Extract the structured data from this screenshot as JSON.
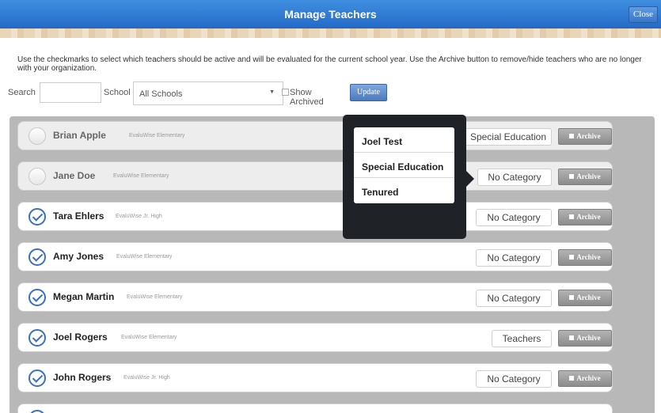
{
  "window": {
    "title": "Manage Teachers",
    "close_label": "Close"
  },
  "instructions": "Use the checkmarks to select which teachers should be active and will be evaluated for the current school year. Use the Archive button to remove/hide teachers who are no longer with your organization.",
  "filters": {
    "search_label": "Search",
    "search_value": "",
    "school_label": "School",
    "school_selected": "All Schools",
    "show_archived_label": "Show Archived",
    "update_label": "Update"
  },
  "archive_label": "Archive",
  "teachers": [
    {
      "name": "Brian Apple",
      "school": "EvaluWise Elementary",
      "category": "Special Education",
      "active": false
    },
    {
      "name": "Jane Doe",
      "school": "EvaluWise Elementary",
      "category": "No Category",
      "active": false
    },
    {
      "name": "Tara Ehlers",
      "school": "EvaluWise Jr. High",
      "category": "No Category",
      "active": true
    },
    {
      "name": "Amy Jones",
      "school": "EvaluWise Elementary",
      "category": "No Category",
      "active": true
    },
    {
      "name": "Megan Martin",
      "school": "EvaluWise Elementary",
      "category": "No Category",
      "active": true
    },
    {
      "name": "Joel Rogers",
      "school": "EvaluWise Elementary",
      "category": "Teachers",
      "active": true
    },
    {
      "name": "John Rogers",
      "school": "EvaluWise Jr. High",
      "category": "No Category",
      "active": true
    }
  ],
  "category_menu": [
    "Joel Test",
    "Special Education",
    "Tenured"
  ],
  "colors": {
    "title_bar": "#2f7cd6",
    "check_active": "#3a6fc4",
    "popover_bg": "#1f2327",
    "panel_bg": "#b8b8b8"
  }
}
